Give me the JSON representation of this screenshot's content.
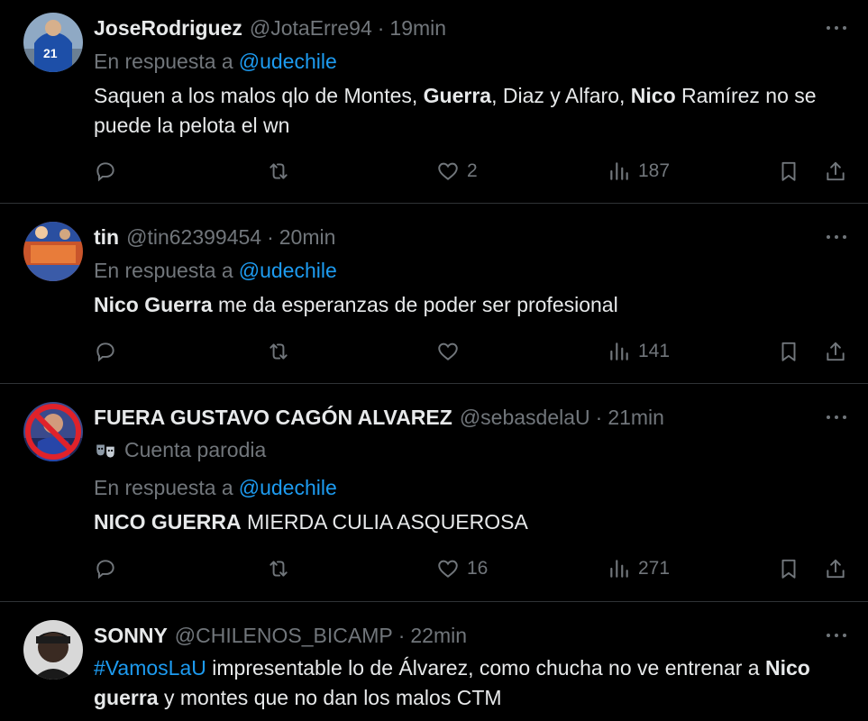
{
  "reply_prefix": "En respuesta a",
  "tweets": [
    {
      "name": "JoseRodriguez",
      "handle": "@JotaErre94",
      "sep": "·",
      "time": "19min",
      "reply_to": "@udechile",
      "text": [
        {
          "t": "Saquen a los malos qlo de Montes, ",
          "b": false
        },
        {
          "t": "Guerra",
          "b": true
        },
        {
          "t": ", Diaz y Alfaro, ",
          "b": false
        },
        {
          "t": "Nico",
          "b": true
        },
        {
          "t": " Ramírez no se puede la pelota el wn",
          "b": false
        }
      ],
      "likes": "2",
      "views": "187"
    },
    {
      "name": "tin",
      "handle": "@tin62399454",
      "sep": "·",
      "time": "20min",
      "reply_to": "@udechile",
      "text": [
        {
          "t": "Nico Guerra",
          "b": true
        },
        {
          "t": " me da esperanzas de poder ser profesional",
          "b": false
        }
      ],
      "likes": "",
      "views": "141"
    },
    {
      "name": "FUERA GUSTAVO CAGÓN ALVAREZ",
      "handle": "@sebasdelaU",
      "sep": "·",
      "time": "21min",
      "parody_label": "Cuenta parodia",
      "reply_to": "@udechile",
      "text": [
        {
          "t": "NICO GUERRA",
          "b": true
        },
        {
          "t": " MIERDA CULIA ASQUEROSA",
          "b": false
        }
      ],
      "likes": "16",
      "views": "271"
    },
    {
      "name": "SONNY",
      "handle": "@CHILENOS_BICAMP",
      "sep": "·",
      "time": "22min",
      "text": [
        {
          "t": "#VamosLaU",
          "h": true
        },
        {
          "t": " impresentable lo de Álvarez, como chucha no ve entrenar a ",
          "b": false
        },
        {
          "t": "Nico guerra",
          "b": true
        },
        {
          "t": " y montes que no dan los malos CTM",
          "b": false
        }
      ]
    }
  ],
  "colors": {
    "background": "#000000",
    "text": "#e7e9ea",
    "muted": "#71767b",
    "link": "#1d9bf0",
    "divider": "#2f3336"
  },
  "icons": [
    "reply-icon",
    "retweet-icon",
    "like-icon",
    "views-icon",
    "bookmark-icon",
    "share-icon",
    "more-icon",
    "parody-mask-icon"
  ]
}
